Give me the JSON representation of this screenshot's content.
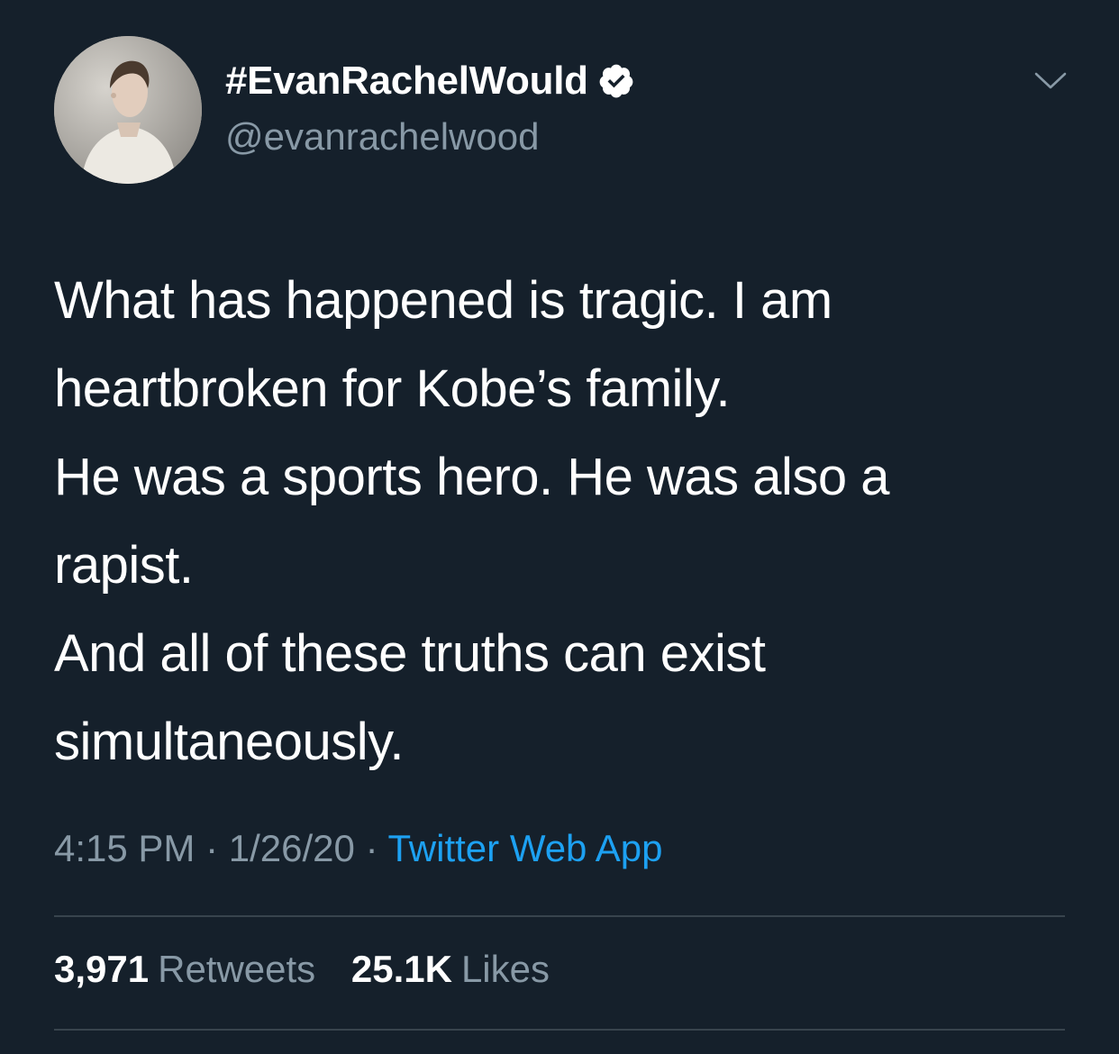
{
  "author": {
    "display_name": "#EvanRachelWould",
    "handle": "@evanrachelwood",
    "verified": true
  },
  "tweet": {
    "lines": [
      "What has happened is tragic. I am",
      "heartbroken for Kobe’s family.",
      "He was a sports hero. He was also a",
      "rapist.",
      "And all of these truths can exist",
      "simultaneously."
    ]
  },
  "meta": {
    "time": "4:15 PM",
    "separator": "·",
    "date": "1/26/20",
    "source": "Twitter Web App"
  },
  "stats": {
    "retweets_count": "3,971",
    "retweets_label": "Retweets",
    "likes_count": "25.1K",
    "likes_label": "Likes"
  },
  "icons": {
    "verified": "verified-badge-icon",
    "menu": "chevron-down-icon"
  },
  "colors": {
    "background": "#15202b",
    "text_primary": "#ffffff",
    "text_secondary": "#8899a6",
    "link": "#1da1f2",
    "divider": "#38444d"
  }
}
